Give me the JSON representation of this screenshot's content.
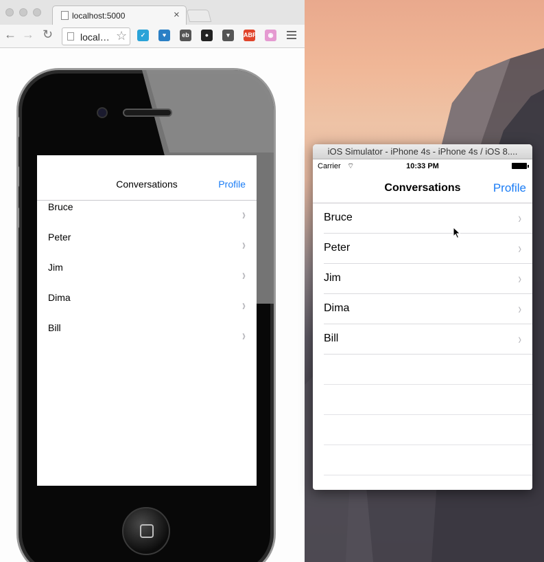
{
  "browser": {
    "tab_title": "localhost:5000",
    "tab_close": "×",
    "url": "local…",
    "star": "☆",
    "back": "←",
    "forward": "→",
    "reload": "↻",
    "extensions": [
      {
        "name": "check-extension-icon",
        "color": "#2aa3d8",
        "glyph": "✓"
      },
      {
        "name": "heart-extension-icon",
        "color": "#2a7fc5",
        "glyph": "♥"
      },
      {
        "name": "ebay-extension-icon",
        "color": "#555555",
        "glyph": "eb"
      },
      {
        "name": "ghostery-extension-icon",
        "color": "#222222",
        "glyph": "●"
      },
      {
        "name": "pocket-extension-icon",
        "color": "#555555",
        "glyph": "▾"
      },
      {
        "name": "adblock-extension-icon",
        "color": "#e0442b",
        "glyph": "ABP"
      },
      {
        "name": "colorpicker-extension-icon",
        "color": "#e59ad1",
        "glyph": "◉"
      }
    ]
  },
  "web_app": {
    "nav_title": "Conversations",
    "nav_profile": "Profile",
    "chevron": "›",
    "rows": [
      "Bruce",
      "Peter",
      "Jim",
      "Dima",
      "Bill"
    ]
  },
  "simulator": {
    "window_title": "iOS Simulator - iPhone 4s - iPhone 4s / iOS 8....",
    "carrier": "Carrier",
    "wifi": "⌔",
    "time": "10:33 PM",
    "nav_title": "Conversations",
    "nav_profile": "Profile",
    "chevron": "›",
    "rows": [
      "Bruce",
      "Peter",
      "Jim",
      "Dima",
      "Bill"
    ],
    "empty_rows": 4
  },
  "colors": {
    "ios_blue": "#1a7cf5",
    "chevron_gray": "#b8b8bd"
  }
}
